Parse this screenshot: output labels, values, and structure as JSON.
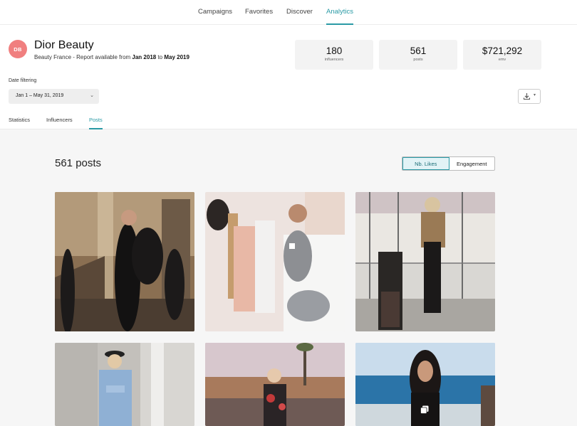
{
  "nav": {
    "items": [
      {
        "label": "Campaigns"
      },
      {
        "label": "Favorites"
      },
      {
        "label": "Discover"
      },
      {
        "label": "Analytics"
      }
    ],
    "active": "Analytics"
  },
  "brand": {
    "initials": "DB",
    "name": "Dior Beauty",
    "account": "Beauty France",
    "report_prefix": " - Report available from ",
    "from": "Jan 2018",
    "to_word": " to ",
    "to": "May 2019"
  },
  "stats": [
    {
      "value": "180",
      "label": "influencers"
    },
    {
      "value": "561",
      "label": "posts"
    },
    {
      "value": "$721,292",
      "label": "emv"
    }
  ],
  "date_filter": {
    "label": "Date filtering",
    "value": "Jan 1 – May 31, 2019"
  },
  "tabs": [
    {
      "label": "Statistics"
    },
    {
      "label": "Influencers"
    },
    {
      "label": "Posts"
    }
  ],
  "active_tab": "Posts",
  "posts_section": {
    "count_label": "561 posts",
    "sort_options": [
      {
        "label": "Nb. Likes"
      },
      {
        "label": "Engagement"
      }
    ],
    "active_sort": "Nb. Likes"
  },
  "colors": {
    "accent": "#2a9aa5",
    "avatar": "#f07f7f"
  },
  "icons": {
    "download": "download-icon",
    "chevron": "chevron-down-icon",
    "multi_post": "multiple-images-icon"
  }
}
